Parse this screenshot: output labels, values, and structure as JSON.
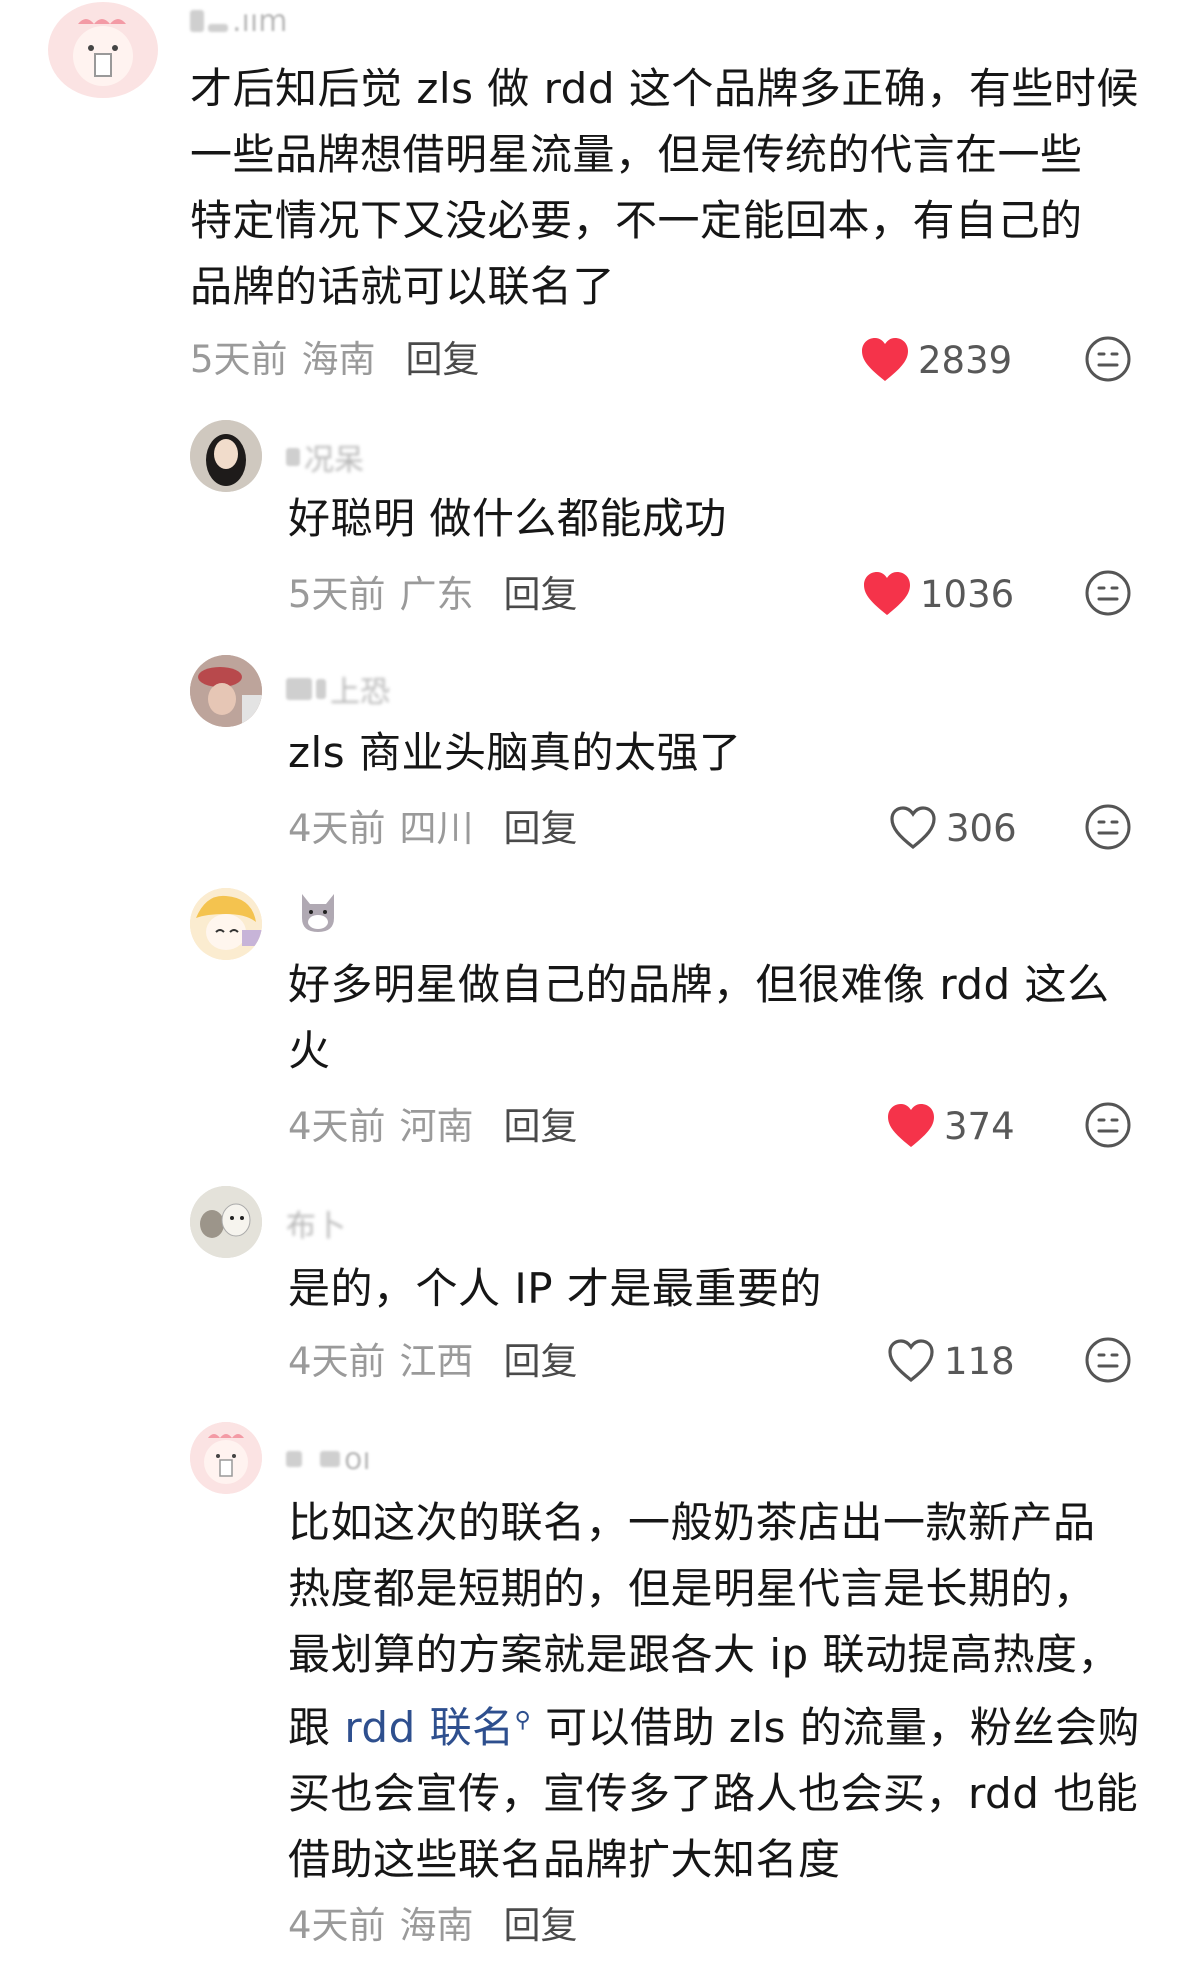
{
  "comments": [
    {
      "username_fragment": ".ıım",
      "text_lines": [
        "才后知后觉 zls 做 rdd 这个品牌多正确，有些时候",
        "一些品牌想借明星流量，但是传统的代言在一些",
        "特定情况下又没必要，不一定能回本，有自己的",
        "品牌的话就可以联名了"
      ],
      "time": "5天前",
      "location": "海南",
      "reply_label": "回复",
      "likes": "2839",
      "liked": true
    },
    {
      "username_fragment": "况呆",
      "text_lines": [
        "好聪明 做什么都能成功"
      ],
      "time": "5天前",
      "location": "广东",
      "reply_label": "回复",
      "likes": "1036",
      "liked": true
    },
    {
      "username_fragment": "上恐",
      "text_lines": [
        "zls 商业头脑真的太强了"
      ],
      "time": "4天前",
      "location": "四川",
      "reply_label": "回复",
      "likes": "306",
      "liked": false
    },
    {
      "username_fragment": "",
      "text_lines": [
        "好多明星做自己的品牌，但很难像 rdd 这么",
        "火"
      ],
      "time": "4天前",
      "location": "河南",
      "reply_label": "回复",
      "likes": "374",
      "liked": true
    },
    {
      "username_fragment": "布卜",
      "text_lines": [
        "是的，个人 IP 才是最重要的"
      ],
      "time": "4天前",
      "location": "江西",
      "reply_label": "回复",
      "likes": "118",
      "liked": false
    },
    {
      "username_fragment": "oı",
      "text_lines": [
        "比如这次的联名，一般奶茶店出一款新产品",
        "热度都是短期的，但是明星代言是长期的，",
        "最划算的方案就是跟各大 ip 联动提高热度，"
      ],
      "line4_prefix": "跟",
      "line4_link": "rdd 联名",
      "line4_suffix": "可以借助 zls 的流量，粉丝会购",
      "text_lines_tail": [
        "买也会宣传，宣传多了路人也会买，rdd 也能",
        "借助这些联名品牌扩大知名度"
      ],
      "time": "4天前",
      "location": "海南",
      "reply_label": "回复"
    }
  ],
  "colors": {
    "like_red": "#f5334a",
    "text": "#161616",
    "meta_gray": "#9a9a9a",
    "link_blue": "#2e4f8e"
  }
}
